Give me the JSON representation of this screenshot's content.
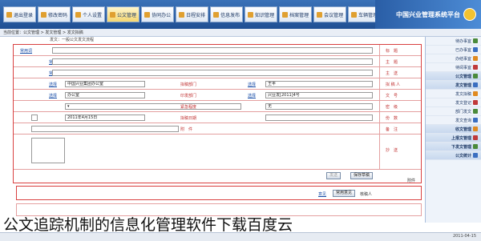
{
  "header": {
    "system_name": "中国兴业管理系统平台"
  },
  "topnav": [
    {
      "label": "退出登录",
      "icon": "exit-icon"
    },
    {
      "label": "修改密码",
      "icon": "key-icon"
    },
    {
      "label": "个人设置",
      "icon": "person-icon"
    },
    {
      "label": "公文管理",
      "icon": "document-icon"
    },
    {
      "label": "协同办公",
      "icon": "collab-icon"
    },
    {
      "label": "日程安排",
      "icon": "calendar-icon"
    },
    {
      "label": "信息发布",
      "icon": "megaphone-icon"
    },
    {
      "label": "知识管理",
      "icon": "book-icon"
    },
    {
      "label": "档案管理",
      "icon": "archive-icon"
    },
    {
      "label": "会议管理",
      "icon": "meeting-icon"
    },
    {
      "label": "车辆管理",
      "icon": "car-icon"
    },
    {
      "label": "通讯录",
      "icon": "contacts-icon"
    },
    {
      "label": "个人办公",
      "icon": "home-icon"
    }
  ],
  "breadcrumb": "当前位置：公文管理 > 发文管理 > 发文拟稿",
  "sidebar": {
    "items": [
      {
        "label": "待办事宜",
        "icon": "inbox-icon",
        "group": false
      },
      {
        "label": "已办事宜",
        "icon": "check-icon",
        "group": false
      },
      {
        "label": "办结事宜",
        "icon": "done-icon",
        "group": false
      },
      {
        "label": "待阅事宜",
        "icon": "read-icon",
        "group": false
      },
      {
        "label": "公文管理",
        "icon": "folder-icon",
        "group": true
      },
      {
        "label": "发文管理",
        "icon": "send-icon",
        "group": true
      },
      {
        "label": "发文拟稿",
        "icon": "edit-icon",
        "group": false
      },
      {
        "label": "发文登记",
        "icon": "register-icon",
        "group": false
      },
      {
        "label": "部门发文",
        "icon": "dept-icon",
        "group": false
      },
      {
        "label": "发文查询",
        "icon": "search-icon",
        "group": false
      },
      {
        "label": "收文管理",
        "icon": "receive-icon",
        "group": true
      },
      {
        "label": "上报文管理",
        "icon": "upload-icon",
        "group": true
      },
      {
        "label": "下发文管理",
        "icon": "download-icon",
        "group": true
      },
      {
        "label": "公文统计",
        "icon": "stats-icon",
        "group": true
      }
    ]
  },
  "form": {
    "panel_title": "发文：一般公文发文流程",
    "title_label": "标　题",
    "title_link": "常用词",
    "subject_label": "主　题",
    "subject_link": "常用词",
    "sender_label": "主　送",
    "sender_link": "常用词",
    "drafter_label": "拟 稿 人",
    "drafter_value": "王丰",
    "drafter_link": "选择",
    "dept_label": "拟稿部门",
    "dept_value": "中国兴业集团办公室",
    "dept_link": "选择",
    "docno_label": "文　号",
    "docno_value": "兴业发[2011]4号",
    "docno_link": "选择",
    "printdept_label": "印发部门",
    "printdept_value": "办公室",
    "printdept_link": "选择",
    "secret_label": "密　级",
    "secret_value": "无",
    "urgent_label": "紧急程度",
    "urgent_value": "一般",
    "copies_label": "份　数",
    "date_label": "拟稿日期",
    "date_value": "2011年4月15日",
    "attach_label": "附　件",
    "remark_label": "备　注",
    "cc_label": "抄　送",
    "save_button": "保存草稿",
    "submit_button": "发送",
    "note_label": "附件"
  },
  "lower": {
    "opinion_label": "核稿人",
    "opinion_button": "常用意见",
    "opinion_link": "意见"
  },
  "caption": "公文追踪机制的信息化管理软件下载百度云",
  "status": {
    "right_text": "2011-04-15"
  },
  "colors": {
    "header_blue": "#1f4f93",
    "form_border_red": "#d94040",
    "label_red": "#c03030",
    "link_blue": "#1a4fa8"
  }
}
